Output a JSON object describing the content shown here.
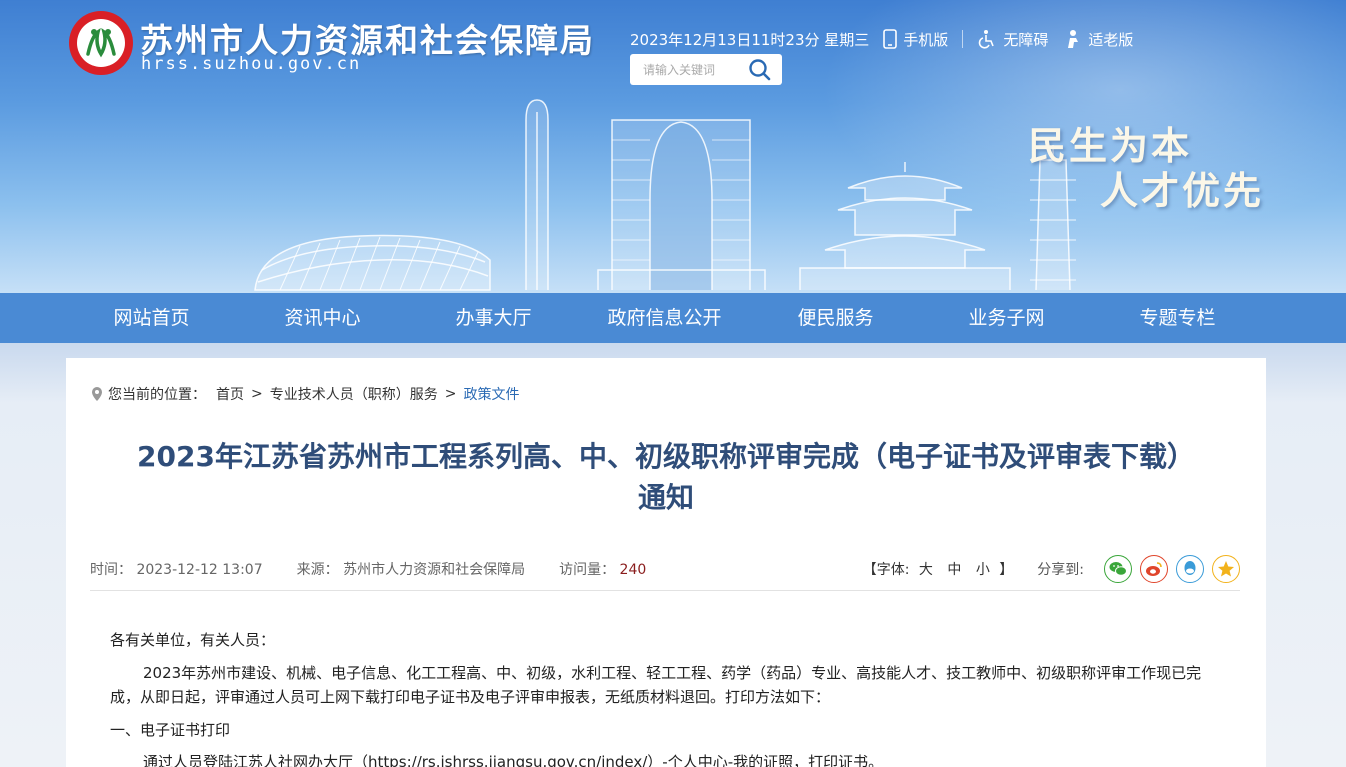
{
  "header": {
    "site_title": "苏州市人力资源和社会保障局",
    "site_domain": "hrss.suzhou.gov.cn",
    "datetime": "2023年12月13日11时23分 星期三",
    "mobile_label": "手机版",
    "accessibility_label": "无障碍",
    "elderly_label": "适老版",
    "search_placeholder": "请输入关键词",
    "slogan_line1": "民生为本",
    "slogan_line2": "人才优先"
  },
  "nav": {
    "items": [
      "网站首页",
      "资讯中心",
      "办事大厅",
      "政府信息公开",
      "便民服务",
      "业务子网",
      "专题专栏"
    ]
  },
  "breadcrumb": {
    "prefix": "您当前的位置：",
    "items": [
      "首页",
      "专业技术人员（职称）服务",
      "政策文件"
    ]
  },
  "article": {
    "title_line1": "2023年江苏省苏州市工程系列高、中、初级职称评审完成（电子证书及评审表下载）",
    "title_line2": "通知",
    "time_label": "时间：",
    "time_value": "2023-12-12 13:07",
    "source_label": "来源：",
    "source_value": "苏州市人力资源和社会保障局",
    "visits_label": "访问量：",
    "visits_value": "240",
    "font_open": "【字体:",
    "font_large": "大",
    "font_medium": "中",
    "font_small": "小",
    "font_close": "】",
    "share_label": "分享到:",
    "paragraphs": [
      "各有关单位，有关人员：",
      "2023年苏州市建设、机械、电子信息、化工工程高、中、初级，水利工程、轻工工程、药学（药品）专业、高技能人才、技工教师中、初级职称评审工作现已完成，从即日起，评审通过人员可上网下载打印电子证书及电子评审申报表，无纸质材料退回。打印方法如下：",
      "一、电子证书打印",
      "通过人员登陆江苏人社网办大厅（https://rs.jshrss.jiangsu.gov.cn/index/）-个人中心-我的证照，打印证书。"
    ]
  },
  "colors": {
    "nav_bg": "#4a8ad4",
    "title_color": "#2f4d79",
    "visits_color": "#8a1d1d",
    "wechat": "#3aa63a",
    "weibo": "#e0452b",
    "qq": "#3a9bd8",
    "qzone": "#f2b21b"
  },
  "icons": [
    "location-pin-icon",
    "mobile-phone-icon",
    "wheelchair-icon",
    "elderly-icon",
    "search-icon",
    "wechat-icon",
    "weibo-icon",
    "qq-icon",
    "qzone-icon"
  ]
}
